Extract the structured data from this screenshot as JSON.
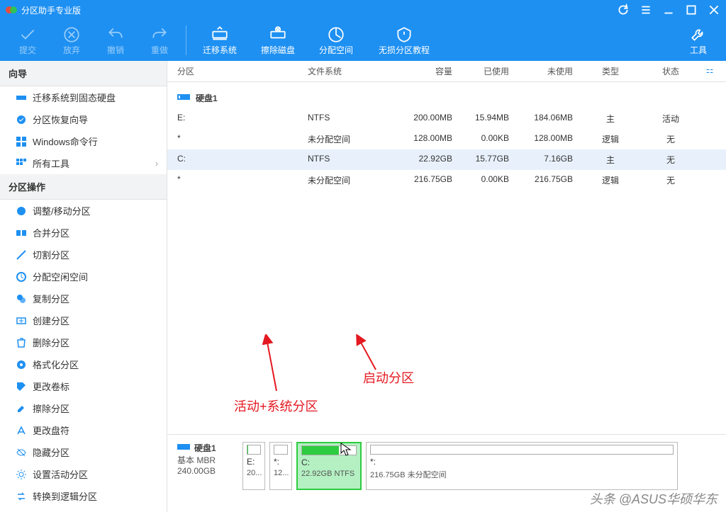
{
  "app": {
    "title": "分区助手专业版"
  },
  "toolbar": {
    "commit": "提交",
    "discard": "放弃",
    "undo": "撤销",
    "redo": "重做",
    "migrate": "迁移系统",
    "wipe": "擦除磁盘",
    "alloc": "分配空间",
    "tutorial": "无损分区教程",
    "tools": "工具"
  },
  "sidebar": {
    "wizard_title": "向导",
    "wizard": {
      "migrate_ssd": "迁移系统到固态硬盘",
      "recover": "分区恢复向导",
      "cmdline": "Windows命令行",
      "all_tools": "所有工具"
    },
    "ops_title": "分区操作",
    "ops": {
      "resize": "调整/移动分区",
      "merge": "合并分区",
      "split": "切割分区",
      "alloc_free": "分配空闲空间",
      "copy": "复制分区",
      "create": "创建分区",
      "delete": "删除分区",
      "format": "格式化分区",
      "label": "更改卷标",
      "wipe": "擦除分区",
      "letter": "更改盘符",
      "hide": "隐藏分区",
      "set_active": "设置活动分区",
      "to_logical": "转换到逻辑分区"
    }
  },
  "grid": {
    "headers": {
      "partition": "分区",
      "fs": "文件系统",
      "cap": "容量",
      "used": "已使用",
      "free": "未使用",
      "type": "类型",
      "status": "状态"
    },
    "disk_label": "硬盘1",
    "rows": [
      {
        "part": "E:",
        "fs": "NTFS",
        "cap": "200.00MB",
        "used": "15.94MB",
        "free": "184.06MB",
        "type": "主",
        "status": "活动"
      },
      {
        "part": "*",
        "fs": "未分配空间",
        "cap": "128.00MB",
        "used": "0.00KB",
        "free": "128.00MB",
        "type": "逻辑",
        "status": "无"
      },
      {
        "part": "C:",
        "fs": "NTFS",
        "cap": "22.92GB",
        "used": "15.77GB",
        "free": "7.16GB",
        "type": "主",
        "status": "无",
        "selected": true
      },
      {
        "part": "*",
        "fs": "未分配空间",
        "cap": "216.75GB",
        "used": "0.00KB",
        "free": "216.75GB",
        "type": "逻辑",
        "status": "无"
      }
    ]
  },
  "vis": {
    "disk": {
      "title": "硬盘1",
      "sub1": "基本 MBR",
      "sub2": "240.00GB"
    },
    "parts": [
      {
        "letter": "E:",
        "size": "20...",
        "fill": 8
      },
      {
        "letter": "*:",
        "size": "12...",
        "fill": 0
      },
      {
        "letter": "C:",
        "size": "22.92GB NTFS",
        "fill": 68,
        "selected": true
      },
      {
        "letter": "*:",
        "size": "216.75GB 未分配空间",
        "fill": 0
      }
    ]
  },
  "annot": {
    "active_system": "活动+系统分区",
    "boot": "启动分区"
  },
  "watermark": "头条 @ASUS华硕华东"
}
